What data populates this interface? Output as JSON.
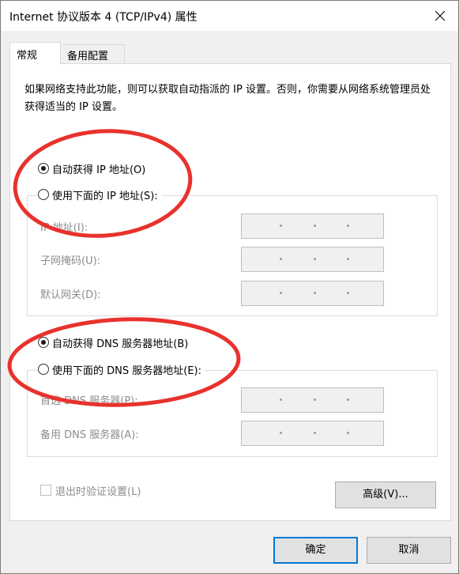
{
  "window": {
    "title": "Internet 协议版本 4 (TCP/IPv4) 属性"
  },
  "tabs": [
    {
      "label": "常规",
      "selected": true
    },
    {
      "label": "备用配置",
      "selected": false
    }
  ],
  "description": "如果网络支持此功能，则可以获取自动指派的 IP 设置。否则，你需要从网络系统管理员处获得适当的 IP 设置。",
  "ip_section": {
    "auto_label": "自动获得 IP 地址(O)",
    "auto_checked": true,
    "manual_label": "使用下面的 IP 地址(S):",
    "manual_checked": false,
    "fields": [
      {
        "label": "IP 地址(I):",
        "value": ""
      },
      {
        "label": "子网掩码(U):",
        "value": ""
      },
      {
        "label": "默认网关(D):",
        "value": ""
      }
    ]
  },
  "dns_section": {
    "auto_label": "自动获得 DNS 服务器地址(B)",
    "auto_checked": true,
    "manual_label": "使用下面的 DNS 服务器地址(E):",
    "manual_checked": false,
    "fields": [
      {
        "label": "首选 DNS 服务器(P):",
        "value": ""
      },
      {
        "label": "备用 DNS 服务器(A):",
        "value": ""
      }
    ]
  },
  "validate_checkbox": {
    "label": "退出时验证设置(L)",
    "checked": false
  },
  "buttons": {
    "advanced": "高级(V)...",
    "ok": "确定",
    "cancel": "取消"
  },
  "colors": {
    "annotation_circle": "#e8322d",
    "default_button_border": "#0078d7",
    "disabled_text": "#8c8c8c"
  }
}
